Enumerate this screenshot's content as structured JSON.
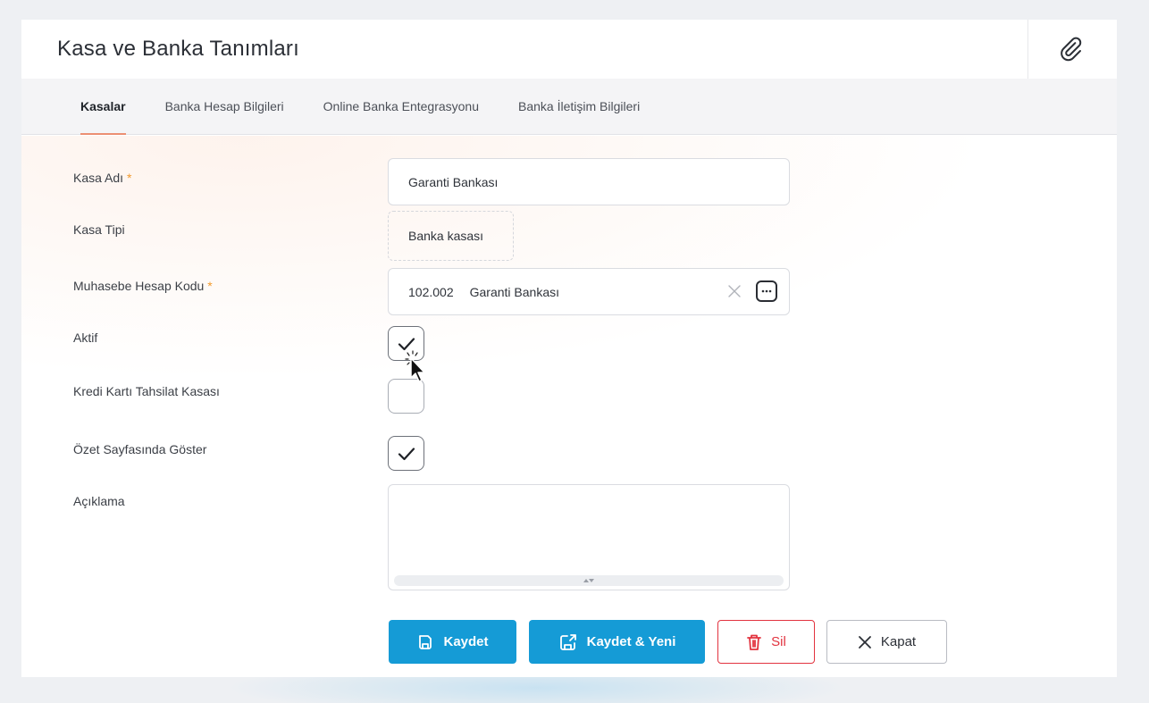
{
  "header": {
    "title": "Kasa ve Banka Tanımları",
    "attach_icon": "paperclip-icon"
  },
  "tabs": [
    {
      "label": "Kasalar",
      "active": true
    },
    {
      "label": "Banka Hesap Bilgileri",
      "active": false
    },
    {
      "label": "Online Banka Entegrasyonu",
      "active": false
    },
    {
      "label": "Banka İletişim Bilgileri",
      "active": false
    }
  ],
  "form": {
    "kasa_adi": {
      "label": "Kasa Adı",
      "required_mark": "*",
      "value": "Garanti Bankası"
    },
    "kasa_tipi": {
      "label": "Kasa Tipi",
      "value": "Banka kasası"
    },
    "muhasebe": {
      "label": "Muhasebe Hesap Kodu",
      "required_mark": "*",
      "code": "102.002",
      "name": "Garanti Bankası"
    },
    "aktif": {
      "label": "Aktif",
      "checked": true
    },
    "kredi_karti": {
      "label": "Kredi Kartı Tahsilat Kasası",
      "checked": false
    },
    "ozet": {
      "label": "Özet Sayfasında Göster",
      "checked": true
    },
    "aciklama": {
      "label": "Açıklama",
      "value": ""
    }
  },
  "actions": {
    "save": "Kaydet",
    "save_new": "Kaydet & Yeni",
    "delete": "Sil",
    "close": "Kapat"
  },
  "colors": {
    "primary": "#159bd6",
    "danger": "#e2333f",
    "tab_underline": "#ec8f72",
    "required": "#f29b2e"
  }
}
